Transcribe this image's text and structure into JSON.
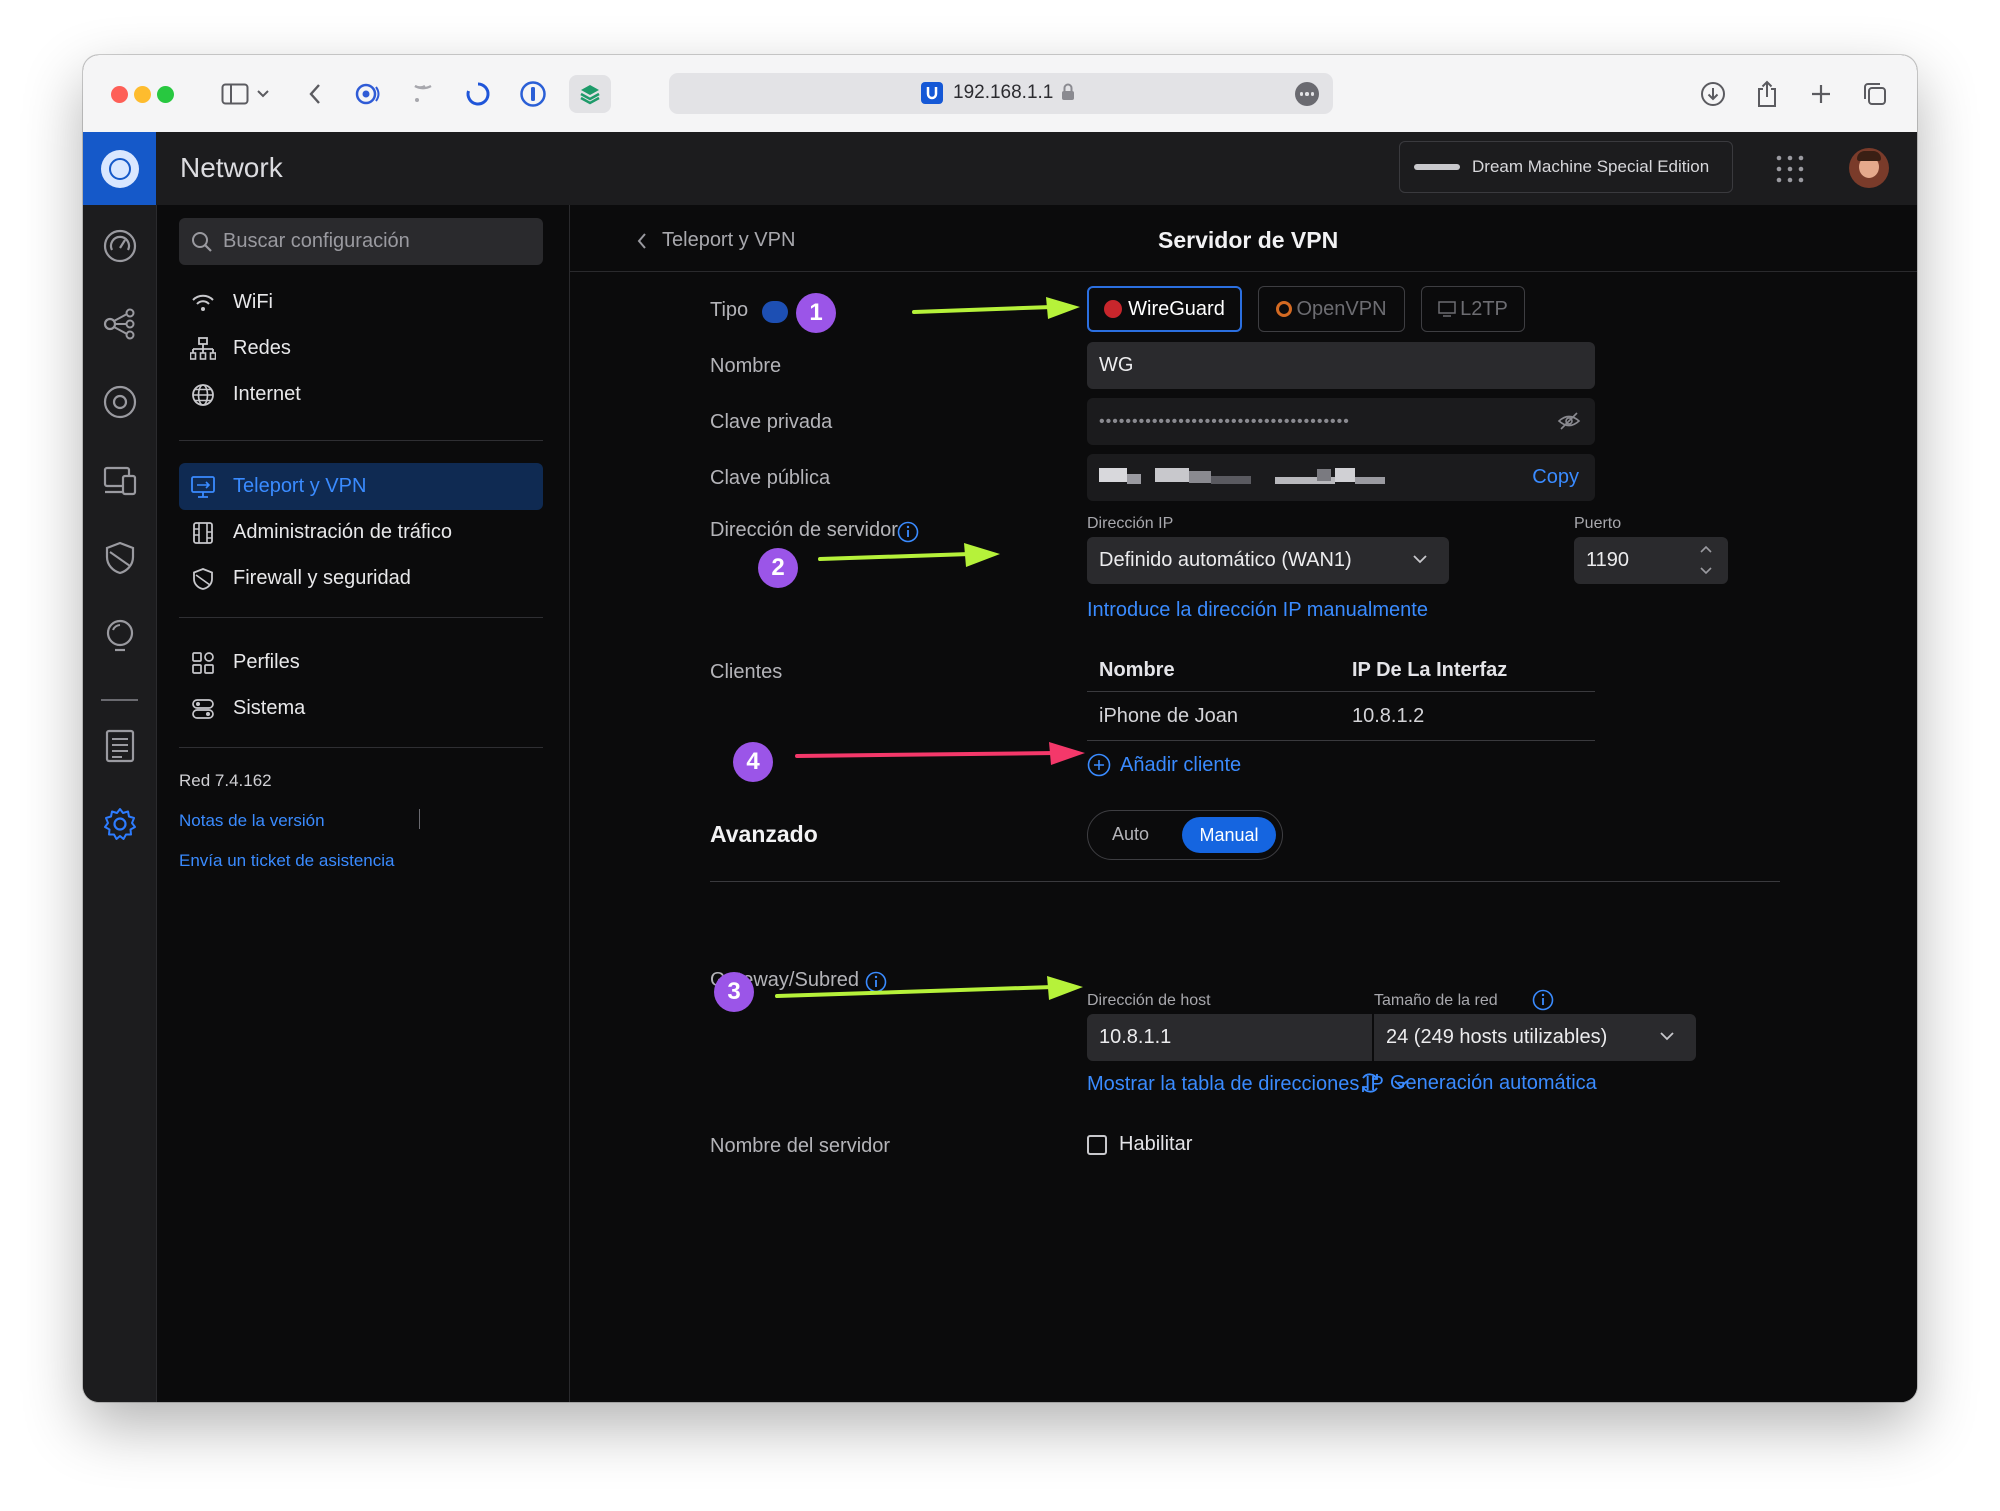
{
  "browser": {
    "url": "192.168.1.1"
  },
  "app": {
    "title": "Network",
    "device": "Dream Machine Special Edition"
  },
  "sidebar": {
    "search_placeholder": "Buscar configuración",
    "items": [
      {
        "label": "WiFi",
        "icon": "wifi-icon"
      },
      {
        "label": "Redes",
        "icon": "network-tree-icon"
      },
      {
        "label": "Internet",
        "icon": "globe-icon"
      },
      {
        "label": "Teleport y VPN",
        "icon": "vpn-monitor-icon",
        "active": true
      },
      {
        "label": "Administración de tráfico",
        "icon": "traffic-icon"
      },
      {
        "label": "Firewall y seguridad",
        "icon": "shield-icon"
      },
      {
        "label": "Perfiles",
        "icon": "profiles-icon"
      },
      {
        "label": "Sistema",
        "icon": "system-icon"
      }
    ],
    "version": "Red 7.4.162",
    "release_notes": "Notas de la versión",
    "support_ticket": "Envía un ticket de asistencia"
  },
  "header": {
    "back_label": "Teleport y VPN",
    "title": "Servidor de VPN"
  },
  "form": {
    "tipo_label": "Tipo",
    "types": [
      "WireGuard",
      "OpenVPN",
      "L2TP"
    ],
    "nombre_label": "Nombre",
    "nombre_value": "WG",
    "private_key_label": "Clave privada",
    "private_key_value": "••••••••••••••••••••••••••••••••••••••",
    "public_key_label": "Clave pública",
    "copy_label": "Copy",
    "server_address_label": "Dirección de servidor",
    "ip_label": "Dirección IP",
    "ip_value": "Definido automático (WAN1)",
    "port_label": "Puerto",
    "port_value": "1190",
    "manual_ip_link": "Introduce la dirección IP manualmente",
    "clients_label": "Clientes",
    "clients_table": {
      "headers": [
        "Nombre",
        "IP De La Interfaz"
      ],
      "rows": [
        [
          "iPhone de Joan",
          "10.8.1.2"
        ]
      ]
    },
    "add_client": "Añadir cliente",
    "advanced_label": "Avanzado",
    "advanced_options": [
      "Auto",
      "Manual"
    ],
    "advanced_selected": "Manual",
    "gateway_label": "Gateway/Subred",
    "host_label": "Dirección de host",
    "host_value": "10.8.1.1",
    "netsize_label": "Tamaño de la red",
    "netsize_value": "24 (249 hosts utilizables)",
    "show_ip_table": "Mostrar la tabla de direcciones IP",
    "auto_generate": "Generación automática",
    "server_name_label": "Nombre del servidor",
    "enable_label": "Habilitar"
  },
  "annotations": [
    "1",
    "2",
    "3",
    "4"
  ],
  "colors": {
    "accent": "#3a8bff",
    "badge": "#9b55e8",
    "arrow_green": "#b6f23a",
    "arrow_pink": "#f4386a",
    "sidebar_active": "#0f2a52"
  }
}
